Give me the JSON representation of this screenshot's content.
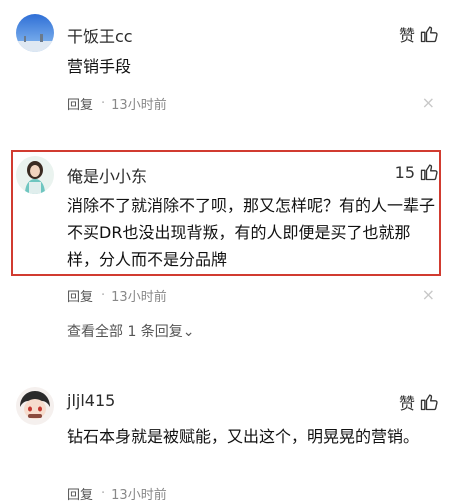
{
  "comments": [
    {
      "username": "干饭王cc",
      "like_label": "赞",
      "text": "营销手段",
      "reply_label": "回复",
      "time": "13小时前",
      "close_glyph": "×"
    },
    {
      "username": "俺是小小东",
      "like_label": "15",
      "text": "消除不了就消除不了呗，那又怎样呢？有的人一辈子不买DR也没出现背叛，有的人即便是买了也就那样，分人而不是分品牌",
      "reply_label": "回复",
      "time": "13小时前",
      "close_glyph": "×",
      "view_replies": "查看全部 1 条回复⌄"
    },
    {
      "username": "jljl415",
      "like_label": "赞",
      "text": "钻石本身就是被赋能，又出这个，明晃晃的营销。",
      "reply_label": "回复",
      "time": "13小时前"
    }
  ],
  "colors": {
    "highlight_border": "#d13b30",
    "meta_text": "#888888"
  }
}
